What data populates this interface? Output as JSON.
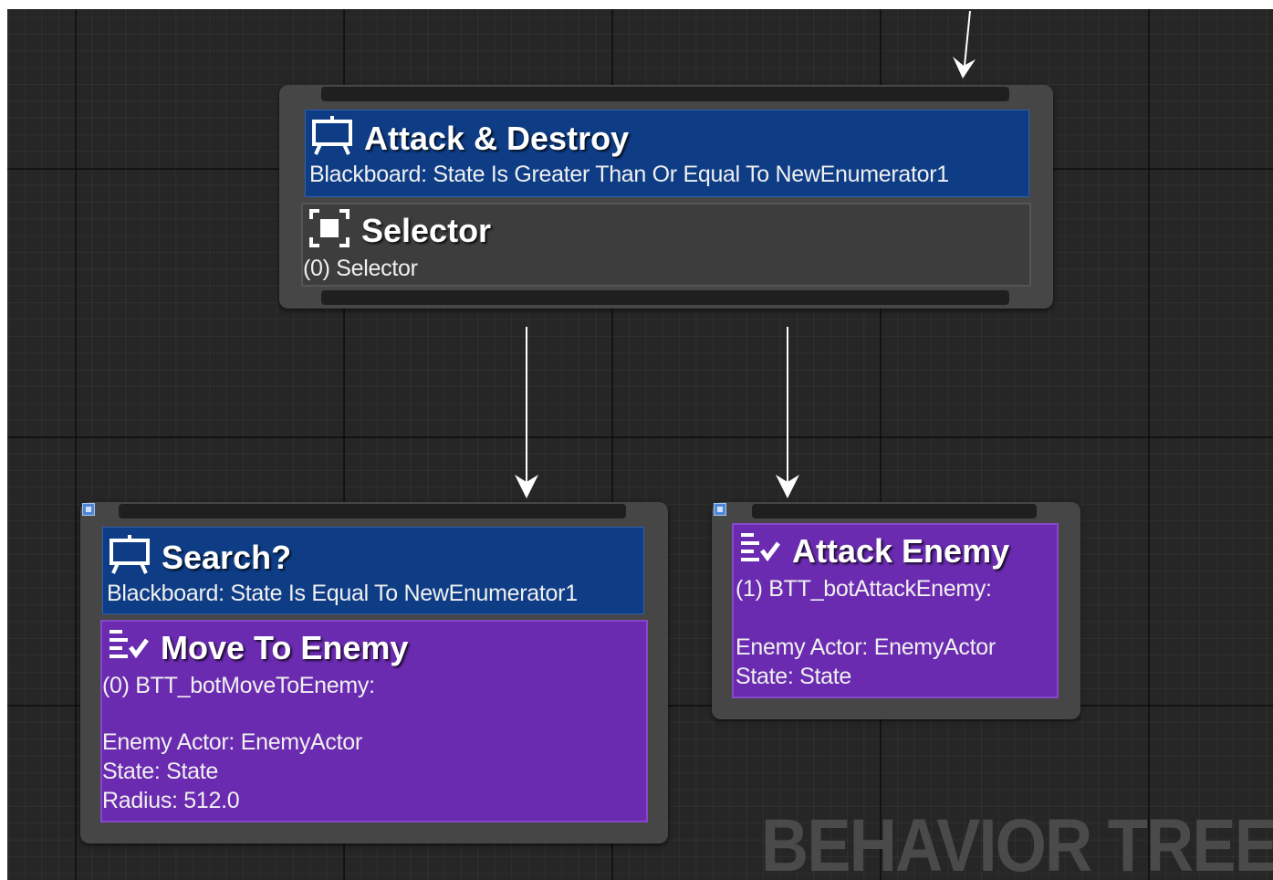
{
  "editor": {
    "watermark": "BEHAVIOR TREE",
    "background_color": "#262626"
  },
  "root_node": {
    "decorator": {
      "icon": "blackboard-decorator-icon",
      "title": "Attack & Destroy",
      "subtitle": "Blackboard: State Is Greater Than Or Equal To NewEnumerator1",
      "color": "#0e3d86"
    },
    "composite": {
      "icon": "selector-icon",
      "title": "Selector",
      "subtitle": "(0) Selector",
      "color": "#3d3d3d"
    }
  },
  "left_node": {
    "decorator": {
      "icon": "blackboard-decorator-icon",
      "title": "Search?",
      "subtitle": "Blackboard: State Is Equal To NewEnumerator1",
      "color": "#0e3d86"
    },
    "task": {
      "icon": "task-icon",
      "title": "Move To Enemy",
      "subtitle": "(0) BTT_botMoveToEnemy:",
      "properties": [
        "Enemy Actor: EnemyActor",
        "State: State",
        "Radius: 512.0"
      ],
      "color": "#6a2bb0"
    }
  },
  "right_node": {
    "task": {
      "icon": "task-icon",
      "title": "Attack Enemy",
      "subtitle": "(1) BTT_botAttackEnemy:",
      "properties": [
        "Enemy Actor: EnemyActor",
        "State: State"
      ],
      "color": "#6a2bb0"
    }
  }
}
